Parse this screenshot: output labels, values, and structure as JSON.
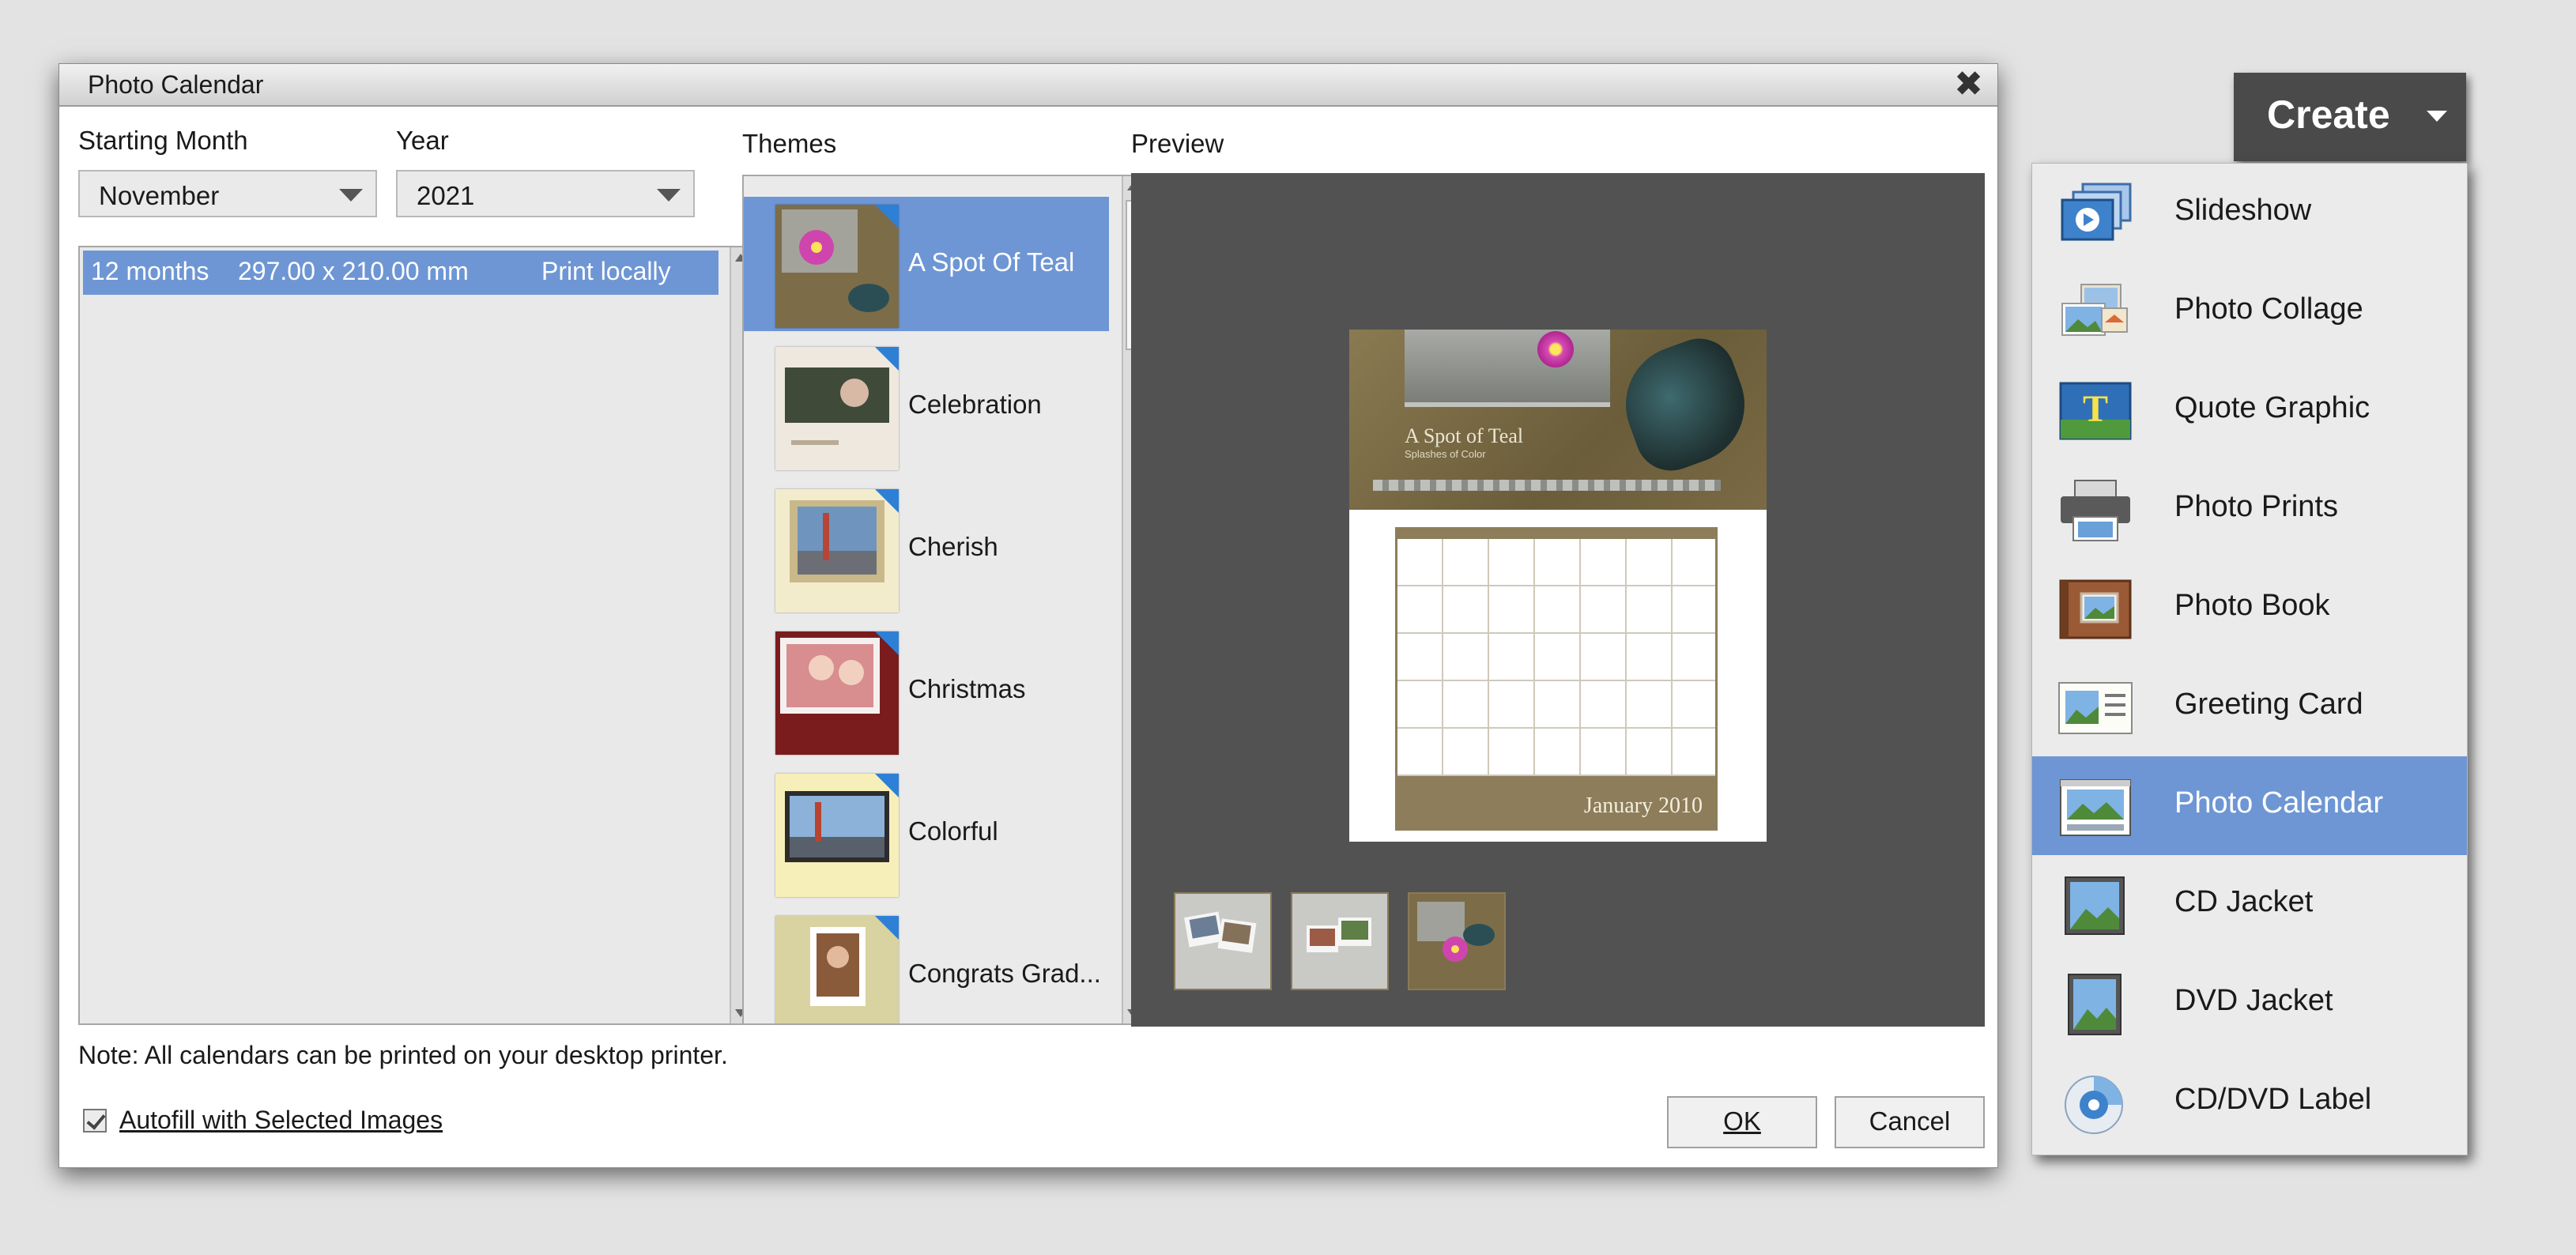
{
  "dialog": {
    "title": "Photo Calendar",
    "close_symbol": "✖",
    "starting_month": {
      "label": "Starting Month",
      "value": "November"
    },
    "year": {
      "label": "Year",
      "value": "2021"
    },
    "sizes": [
      {
        "count": "12 months",
        "dimensions": "297.00 x 210.00 mm",
        "print": "Print locally"
      }
    ],
    "themes_label": "Themes",
    "preview_label": "Preview",
    "themes": [
      {
        "name": "A Spot Of Teal",
        "selected": true
      },
      {
        "name": "Celebration"
      },
      {
        "name": "Cherish"
      },
      {
        "name": "Christmas"
      },
      {
        "name": "Colorful"
      },
      {
        "name": "Congrats Grad..."
      }
    ],
    "preview": {
      "theme_title": "A Spot of Teal",
      "theme_subtitle": "Splashes of Color",
      "month_label": "January 2010"
    },
    "note": "Note: All calendars can be printed on your desktop printer.",
    "autofill": {
      "label": "Autofill with Selected Images",
      "checked": true
    },
    "ok_label": "OK",
    "cancel_label": "Cancel"
  },
  "create": {
    "button_label": "Create",
    "menu": [
      {
        "label": "Slideshow",
        "icon": "slideshow-icon"
      },
      {
        "label": "Photo Collage",
        "icon": "photo-collage-icon"
      },
      {
        "label": "Quote Graphic",
        "icon": "quote-graphic-icon"
      },
      {
        "label": "Photo Prints",
        "icon": "printer-icon"
      },
      {
        "label": "Photo Book",
        "icon": "photo-book-icon"
      },
      {
        "label": "Greeting Card",
        "icon": "greeting-card-icon"
      },
      {
        "label": "Photo Calendar",
        "icon": "photo-calendar-icon",
        "active": true
      },
      {
        "label": "CD Jacket",
        "icon": "cd-jacket-icon"
      },
      {
        "label": "DVD Jacket",
        "icon": "dvd-jacket-icon"
      },
      {
        "label": "CD/DVD Label",
        "icon": "cd-dvd-label-icon"
      }
    ]
  },
  "colors": {
    "selection": "#6e96d4",
    "preview_bg": "#525252",
    "create_button": "#4a4a4a"
  }
}
